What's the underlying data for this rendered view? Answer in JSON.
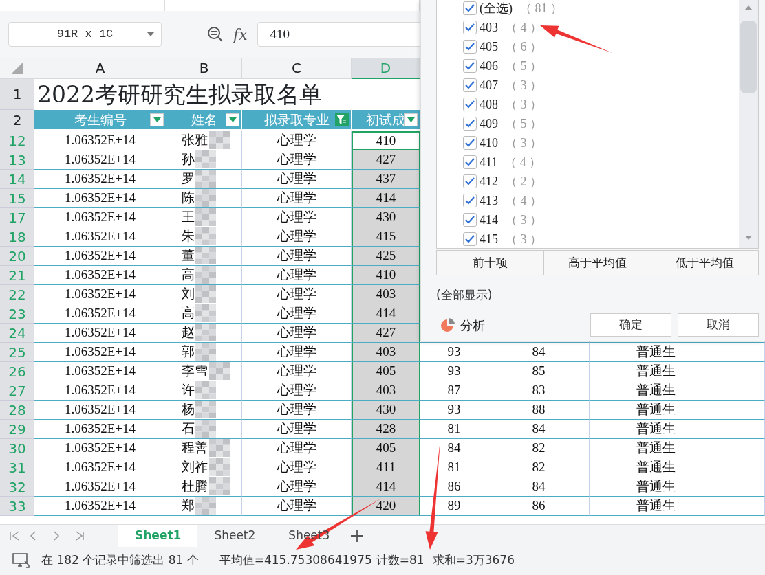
{
  "formula_bar": {
    "name_box": "91R x 1C",
    "fx": "fx",
    "value": "410"
  },
  "columns": [
    {
      "letter": "A",
      "selected": false
    },
    {
      "letter": "B",
      "selected": false
    },
    {
      "letter": "C",
      "selected": false
    },
    {
      "letter": "D",
      "selected": true
    }
  ],
  "title_row": {
    "row": "1",
    "text": "2022考研研究生拟录取名单"
  },
  "header_row": {
    "row": "2",
    "cells": [
      {
        "text": "考生编号",
        "filtered": false
      },
      {
        "text": "姓名",
        "filtered": false
      },
      {
        "text": "拟录取专业",
        "filtered": true
      },
      {
        "text": "初试成",
        "filtered": false
      }
    ]
  },
  "rows": [
    {
      "row": "12",
      "id": "1.06352E+14",
      "name": "张雅",
      "major": "心理学",
      "score": "410",
      "active": true
    },
    {
      "row": "13",
      "id": "1.06352E+14",
      "name": "孙",
      "major": "心理学",
      "score": "427",
      "active": false
    },
    {
      "row": "14",
      "id": "1.06352E+14",
      "name": "罗",
      "major": "心理学",
      "score": "437",
      "active": false
    },
    {
      "row": "15",
      "id": "1.06352E+14",
      "name": "陈",
      "major": "心理学",
      "score": "414",
      "active": false
    },
    {
      "row": "17",
      "id": "1.06352E+14",
      "name": "王",
      "major": "心理学",
      "score": "430",
      "active": false
    },
    {
      "row": "18",
      "id": "1.06352E+14",
      "name": "朱",
      "major": "心理学",
      "score": "415",
      "active": false
    },
    {
      "row": "20",
      "id": "1.06352E+14",
      "name": "董",
      "major": "心理学",
      "score": "425",
      "active": false
    },
    {
      "row": "21",
      "id": "1.06352E+14",
      "name": "高",
      "major": "心理学",
      "score": "410",
      "active": false
    },
    {
      "row": "22",
      "id": "1.06352E+14",
      "name": "刘",
      "major": "心理学",
      "score": "403",
      "active": false
    },
    {
      "row": "23",
      "id": "1.06352E+14",
      "name": "高",
      "major": "心理学",
      "score": "414",
      "active": false
    },
    {
      "row": "24",
      "id": "1.06352E+14",
      "name": "赵",
      "major": "心理学",
      "score": "427",
      "active": false
    },
    {
      "row": "25",
      "id": "1.06352E+14",
      "name": "郭",
      "major": "心理学",
      "score": "403",
      "active": false,
      "column_5": "93",
      "column_6": "84",
      "column_7": "普通生"
    },
    {
      "row": "26",
      "id": "1.06352E+14",
      "name": "李雪",
      "major": "心理学",
      "score": "405",
      "active": false,
      "column_5": "93",
      "column_6": "85",
      "column_7": "普通生"
    },
    {
      "row": "27",
      "id": "1.06352E+14",
      "name": "许",
      "major": "心理学",
      "score": "403",
      "active": false,
      "column_5": "87",
      "column_6": "83",
      "column_7": "普通生"
    },
    {
      "row": "28",
      "id": "1.06352E+14",
      "name": "杨",
      "major": "心理学",
      "score": "430",
      "active": false,
      "column_5": "93",
      "column_6": "88",
      "column_7": "普通生"
    },
    {
      "row": "29",
      "id": "1.06352E+14",
      "name": "石",
      "major": "心理学",
      "score": "428",
      "active": false,
      "column_5": "81",
      "column_6": "84",
      "column_7": "普通生"
    },
    {
      "row": "30",
      "id": "1.06352E+14",
      "name": "程善",
      "major": "心理学",
      "score": "405",
      "active": false,
      "column_5": "84",
      "column_6": "82",
      "column_7": "普通生"
    },
    {
      "row": "31",
      "id": "1.06352E+14",
      "name": "刘祚",
      "major": "心理学",
      "score": "411",
      "active": false,
      "column_5": "81",
      "column_6": "82",
      "column_7": "普通生"
    },
    {
      "row": "32",
      "id": "1.06352E+14",
      "name": "杜腾",
      "major": "心理学",
      "score": "414",
      "active": false,
      "column_5": "86",
      "column_6": "84",
      "column_7": "普通生"
    },
    {
      "row": "33",
      "id": "1.06352E+14",
      "name": "郑",
      "major": "心理学",
      "score": "420",
      "active": false,
      "column_5": "89",
      "column_6": "86",
      "column_7": "普通生"
    }
  ],
  "filter_panel": {
    "items": [
      {
        "label": "(全选)",
        "count": "（ 81 ）",
        "checked": true
      },
      {
        "label": "403",
        "count": "（ 4 ）",
        "checked": true
      },
      {
        "label": "405",
        "count": "（ 6 ）",
        "checked": true
      },
      {
        "label": "406",
        "count": "（ 5 ）",
        "checked": true
      },
      {
        "label": "407",
        "count": "（ 3 ）",
        "checked": true
      },
      {
        "label": "408",
        "count": "（ 3 ）",
        "checked": true
      },
      {
        "label": "409",
        "count": "（ 5 ）",
        "checked": true
      },
      {
        "label": "410",
        "count": "（ 3 ）",
        "checked": true
      },
      {
        "label": "411",
        "count": "（ 4 ）",
        "checked": true
      },
      {
        "label": "412",
        "count": "（ 2 ）",
        "checked": true
      },
      {
        "label": "413",
        "count": "（ 4 ）",
        "checked": true
      },
      {
        "label": "414",
        "count": "（ 3 ）",
        "checked": true
      },
      {
        "label": "415",
        "count": "（ 3 ）",
        "checked": true
      }
    ],
    "quick_buttons": [
      "前十项",
      "高于平均值",
      "低于平均值"
    ],
    "show_all": "(全部显示)",
    "analyze": "分析",
    "ok": "确定",
    "cancel": "取消"
  },
  "sheet_tabs": [
    {
      "label": "Sheet1",
      "selected": true
    },
    {
      "label": "Sheet2",
      "selected": false
    },
    {
      "label": "Sheet3",
      "selected": false
    }
  ],
  "status_bar": {
    "filter_info": "在 182 个记录中筛选出 81 个",
    "average": "平均值=415.75308641975",
    "count": "计数=81",
    "sum": "求和=3万3676"
  }
}
